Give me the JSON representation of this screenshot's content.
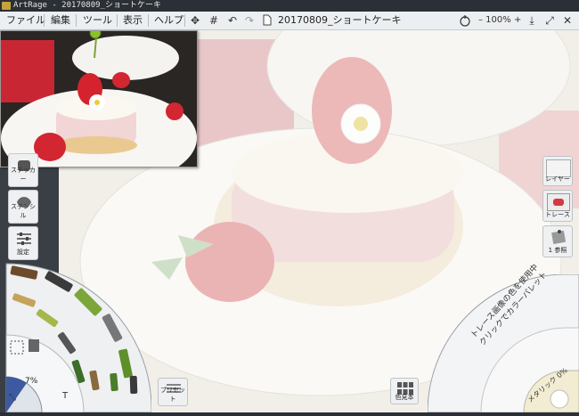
{
  "window": {
    "title": "ArtRage - 20170809_ショートケーキ"
  },
  "menubar": {
    "items": [
      "ファイル",
      "編集",
      "ツール",
      "表示",
      "ヘルプ"
    ],
    "document_title": "20170809_ショートケーキ",
    "zoom_label": "– 100% +"
  },
  "left_panel": {
    "sticker_label": "ステッカー",
    "stencil_label": "ステンシル",
    "settings_label": "設定"
  },
  "right_panel": {
    "layer_label": "レイヤー",
    "trace_label": "トレース",
    "reference_label": "1 参照"
  },
  "bottom_bar": {
    "preset_label": "プリセット",
    "swatches_label": "色見本"
  },
  "tool_picker": {
    "size_label": "7%"
  },
  "color_picker": {
    "trace_text_line1": "トレース画像の色を使用中",
    "trace_text_line2": "クリックでカラーパレット",
    "metallic_label": "メタリック 0%"
  },
  "colors": {
    "titlebar_bg": "#2b2f36",
    "menubar_bg": "#eceff2",
    "canvas_bg": "#f1f0ea",
    "accent_green": "#7aa63a"
  }
}
